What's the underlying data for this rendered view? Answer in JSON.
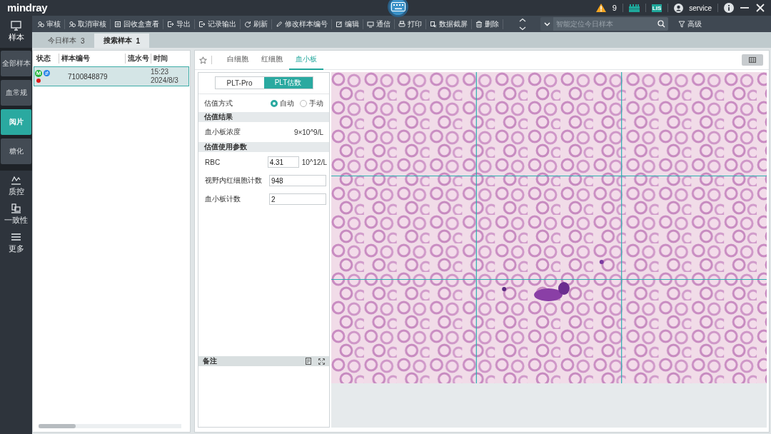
{
  "title_bar": {
    "logo": "mindray",
    "alert_count": "9",
    "lis_badge": "LIS",
    "user": "service"
  },
  "nav": {
    "main": {
      "label": "样本",
      "selected": true
    },
    "sub": [
      {
        "label": "全部样本",
        "selected": false
      },
      {
        "label": "血常规",
        "selected": false
      },
      {
        "label": "阅片",
        "selected": true
      },
      {
        "label": "糖化",
        "selected": false
      }
    ],
    "more": [
      {
        "label": "质控"
      },
      {
        "label": "一致性"
      },
      {
        "label": "更多"
      }
    ]
  },
  "toolbar": {
    "buttons": [
      {
        "label": "审核"
      },
      {
        "label": "取消审核"
      },
      {
        "label": "回收盒查看"
      },
      {
        "label": "导出"
      },
      {
        "label": "记录输出"
      },
      {
        "label": "刷新"
      },
      {
        "label": "修改样本编号"
      },
      {
        "label": "编辑"
      },
      {
        "label": "通信"
      },
      {
        "label": "打印"
      },
      {
        "label": "数据截屏"
      },
      {
        "label": "删除"
      }
    ],
    "search": {
      "placeholder": "智能定位今日样本"
    },
    "filter_button": "高级"
  },
  "sample_tabs": [
    {
      "label": "今日样本",
      "count": "3",
      "selected": false
    },
    {
      "label": "搜索样本",
      "count": "1",
      "selected": true
    }
  ],
  "sample_table": {
    "columns": [
      "状态",
      "样本编号",
      "流水号",
      "时间"
    ],
    "rows": [
      {
        "selected": true,
        "sample_id": "7100848879",
        "time": "15:23",
        "date": "2024/8/3",
        "status_marks": [
          {
            "kind": "badge",
            "text": "M",
            "color": "#22b53c"
          },
          {
            "kind": "sync",
            "color": "#2a86e8"
          },
          {
            "kind": "dot",
            "color": "#e01818"
          }
        ]
      }
    ]
  },
  "view_tabs": [
    {
      "label": "白细胞",
      "selected": false
    },
    {
      "label": "红细胞",
      "selected": false
    },
    {
      "label": "血小板",
      "selected": true
    }
  ],
  "mode_toggle": [
    {
      "label": "PLT-Pro",
      "selected": false
    },
    {
      "label": "PLT估数",
      "selected": true
    }
  ],
  "method": {
    "label": "估值方式",
    "options": [
      {
        "label": "自动",
        "selected": true
      },
      {
        "label": "手动",
        "selected": false
      }
    ]
  },
  "result_section": {
    "title": "估值结果",
    "rows": [
      {
        "label": "血小板浓度",
        "value": "9×10^9/L"
      }
    ]
  },
  "params_section": {
    "title": "估值使用参数",
    "fields": [
      {
        "label": "RBC",
        "value": "4.31",
        "unit": "10^12/L"
      },
      {
        "label": "视野内红细胞计数",
        "value": "948"
      },
      {
        "label": "血小板计数",
        "value": "2"
      }
    ]
  },
  "notes": {
    "title": "备注"
  }
}
